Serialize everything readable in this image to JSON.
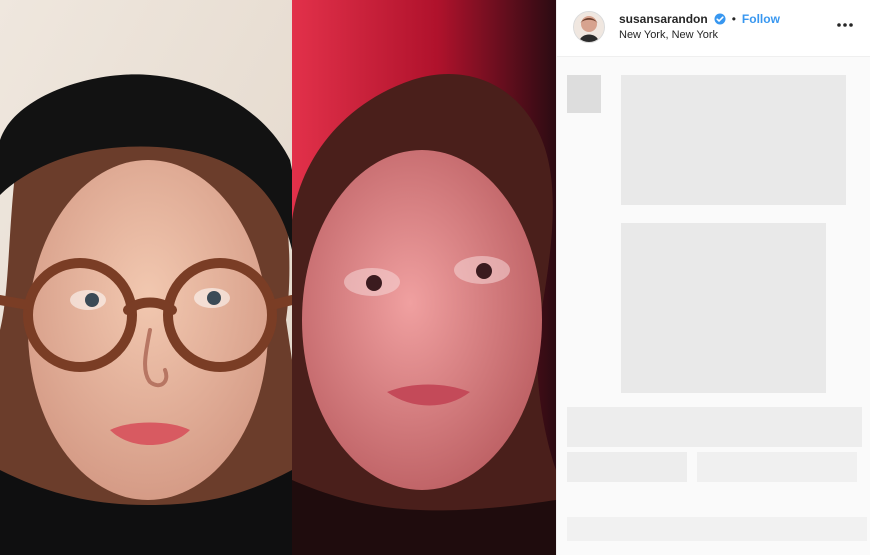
{
  "profile": {
    "username": "susansarandon",
    "follow_label": "Follow",
    "location": "New York, New York",
    "verified": true
  },
  "ui": {
    "separator": "•",
    "more_icon": "more-options-icon"
  },
  "colors": {
    "accent": "#3897f0",
    "verified_badge": "#3897f0",
    "text": "#262626"
  }
}
